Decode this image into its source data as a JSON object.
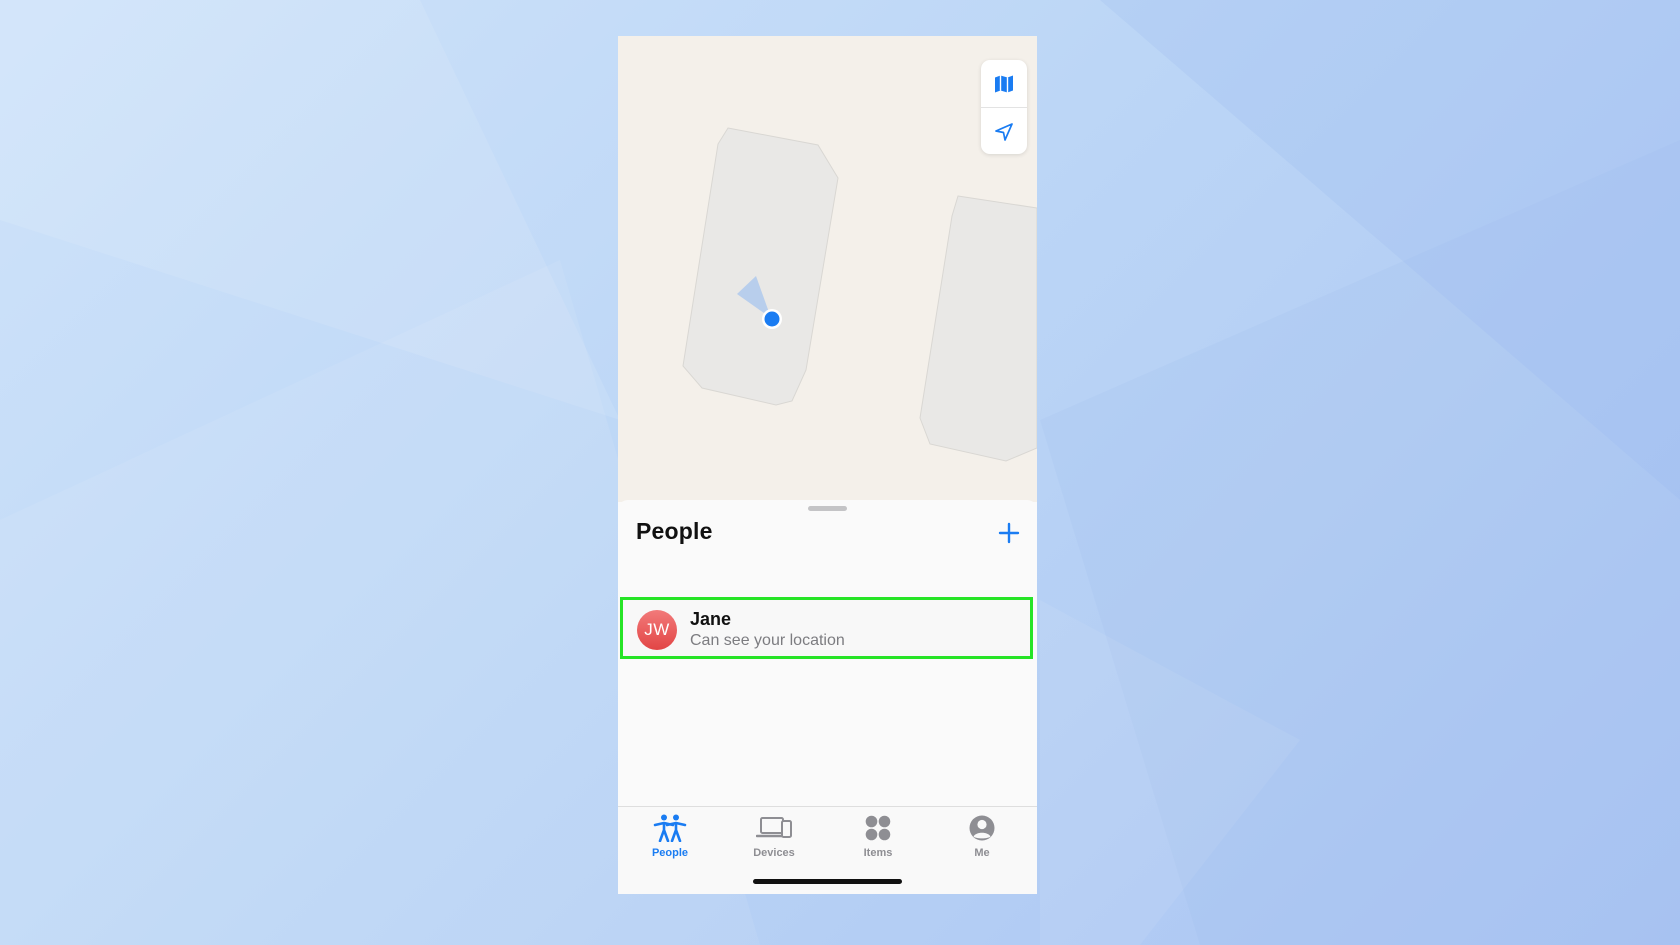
{
  "map": {
    "controls": [
      {
        "icon": "map-icon"
      },
      {
        "icon": "location-arrow-icon"
      }
    ]
  },
  "people_sheet": {
    "title": "People",
    "add_icon": "plus-icon",
    "people": [
      {
        "initials": "JW",
        "name": "Jane",
        "status": "Can see your location"
      }
    ]
  },
  "tabs": [
    {
      "label": "People",
      "icon": "people-icon",
      "active": true
    },
    {
      "label": "Devices",
      "icon": "devices-icon",
      "active": false
    },
    {
      "label": "Items",
      "icon": "items-icon",
      "active": false
    },
    {
      "label": "Me",
      "icon": "me-icon",
      "active": false
    }
  ],
  "colors": {
    "accent": "#1a7cf2",
    "highlight": "#26e426",
    "avatar": "#e24545",
    "inactive_tab": "#8e8e93"
  }
}
